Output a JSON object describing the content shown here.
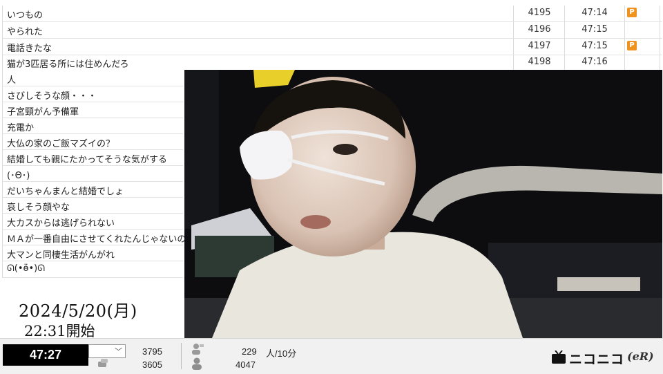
{
  "comments": [
    {
      "text": "いつもの",
      "num": "4195",
      "time": "47:14",
      "premium": "P"
    },
    {
      "text": "やられた",
      "num": "4196",
      "time": "47:15",
      "premium": ""
    },
    {
      "text": "電話きたな",
      "num": "4197",
      "time": "47:15",
      "premium": "P"
    },
    {
      "text": "猫が3匹居る所には住めんだろ",
      "num": "4198",
      "time": "47:16",
      "premium": ""
    },
    {
      "text": "人"
    },
    {
      "text": "さびしそうな顔・・・"
    },
    {
      "text": "子宮頸がん予備軍"
    },
    {
      "text": "充電か"
    },
    {
      "text": "大仏の家のご飯マズイの？"
    },
    {
      "text": "結婚しても親にたかってそうな気がする"
    },
    {
      "text": "(･Θ･)"
    },
    {
      "text": "だいちゃんまんと結婚でしょ"
    },
    {
      "text": "哀しそう顔やな"
    },
    {
      "text": "大カスからは逃げられない"
    },
    {
      "text": "ＭＡが一番自由にさせてくれたんじゃないの"
    },
    {
      "text": "大マンと同棲生活がんがれ"
    },
    {
      "text": "ᘏ(•ӫ•)ᘏ"
    }
  ],
  "overlay": {
    "date": "2024/5/20(月)",
    "start": "22:31開始"
  },
  "status": {
    "elapsed": "47:27",
    "stat_top": "3795",
    "stat_bottom": "3605",
    "viewers_per_10min": "229",
    "viewers_unit": "人/10分",
    "total": "4047"
  },
  "logo": {
    "text": "ニコニコ",
    "suffix": "(eR)"
  },
  "colors": {
    "premium": "#f0931e",
    "timer_bg": "#000000"
  }
}
